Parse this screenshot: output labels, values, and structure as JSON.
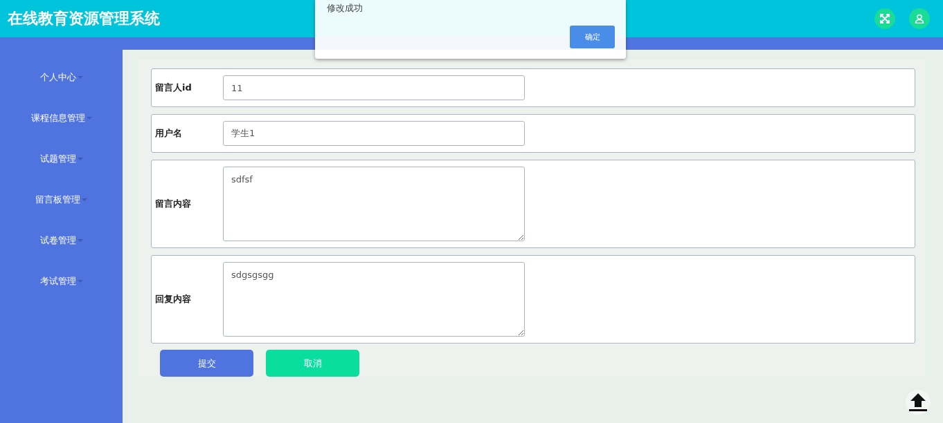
{
  "header": {
    "title": "在线教育资源管理系统"
  },
  "sidebar": {
    "items": [
      {
        "label": "个人中心"
      },
      {
        "label": "课程信息管理"
      },
      {
        "label": "试题管理"
      },
      {
        "label": "留言板管理"
      },
      {
        "label": "试卷管理"
      },
      {
        "label": "考试管理"
      }
    ]
  },
  "form": {
    "fields": [
      {
        "kind": "input",
        "label": "留言人id",
        "value": "11"
      },
      {
        "kind": "input",
        "label": "用户名",
        "value": "学生1"
      },
      {
        "kind": "textarea",
        "label": "留言内容",
        "value": "sdfsf"
      },
      {
        "kind": "textarea",
        "label": "回复内容",
        "value": "sdgsgsgg"
      }
    ],
    "buttons": [
      {
        "kind": "primary",
        "label": "提交"
      },
      {
        "kind": "secondary",
        "label": "取消"
      }
    ]
  },
  "dialog": {
    "message": "修改成功",
    "button": "确定"
  }
}
